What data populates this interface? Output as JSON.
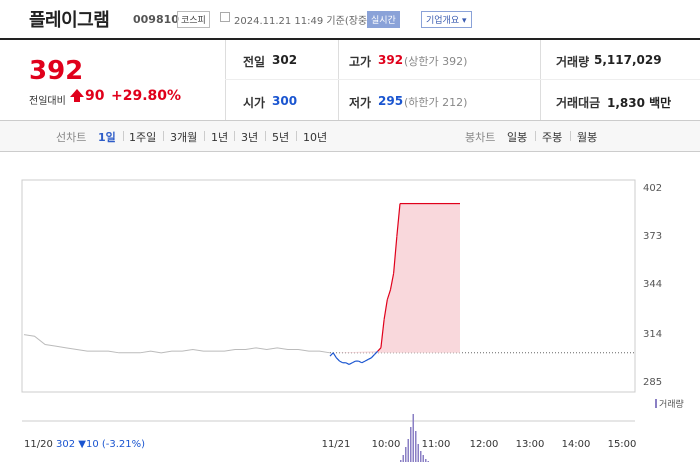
{
  "header": {
    "name": "플레이그램",
    "code": "009810",
    "market": "코스피",
    "datetime": "2024.11.21 11:49 기준(장중)",
    "live_label": "실시간",
    "company_label": "기업개요 ▾"
  },
  "summary": {
    "price": "392",
    "diff_label": "전일대비",
    "diff": "90",
    "pct": "+29.80%",
    "prev_label": "전일",
    "prev_value": "302",
    "open_label": "시가",
    "open_value": "300",
    "high_label": "고가",
    "high_value": "392",
    "high_limit": "(상한가 392)",
    "low_label": "저가",
    "low_value": "295",
    "low_limit": "(하한가 212)",
    "volume_label": "거래량",
    "volume_value": "5,117,029",
    "amount_label": "거래대금",
    "amount_value": "1,830 백만"
  },
  "tabs": {
    "line_label": "선차트",
    "periods": [
      "1일",
      "1주일",
      "3개월",
      "1년",
      "3년",
      "5년",
      "10년"
    ],
    "candle_label": "봉차트",
    "candles": [
      "일봉",
      "주봉",
      "월봉"
    ]
  },
  "colors": {
    "up": "#e0001b",
    "down": "#1a55d0",
    "accent": "#2d5cc8"
  },
  "chart_data": {
    "type": "line",
    "y_ticks": [
      "402",
      "373",
      "344",
      "314",
      "285"
    ],
    "ylim": [
      285,
      402
    ],
    "x_ticks": [
      "11/21",
      "10:00",
      "11:00",
      "12:00",
      "13:00",
      "14:00",
      "15:00"
    ],
    "prev_day_label": "11/20",
    "prev_close_label": "302 ▼10 (-3.21%)",
    "baseline": 302,
    "volume_label": "거래량",
    "prev_day_series": [
      313,
      312,
      307,
      306,
      305,
      304,
      303,
      303,
      303,
      302,
      302,
      302,
      303,
      302,
      303,
      303,
      304,
      303,
      303,
      303,
      304,
      304,
      305,
      304,
      305,
      304,
      304,
      303,
      303,
      302
    ],
    "today_series": [
      300,
      302,
      299,
      297,
      296,
      296,
      295,
      296,
      297,
      297,
      296,
      297,
      298,
      299,
      301,
      303,
      305,
      322,
      334,
      340,
      350,
      372,
      392,
      392,
      392,
      392,
      392,
      392,
      392,
      392,
      392,
      392,
      392,
      392,
      392
    ]
  }
}
